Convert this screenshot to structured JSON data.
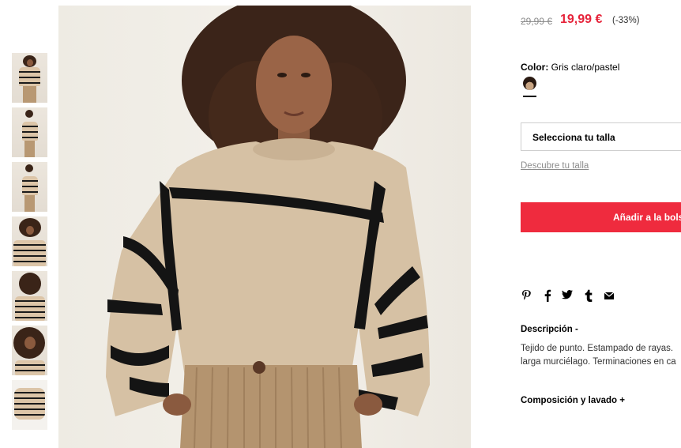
{
  "gallery": {
    "thumbnails": [
      {
        "alt": "model-front-full"
      },
      {
        "alt": "model-side-full"
      },
      {
        "alt": "model-back-full"
      },
      {
        "alt": "model-front-closeup"
      },
      {
        "alt": "model-side-closeup"
      },
      {
        "alt": "model-face-closeup"
      },
      {
        "alt": "sweater-flat"
      }
    ]
  },
  "price": {
    "old": "29,99 €",
    "current": "19,99 €",
    "discount": "(-33%)",
    "sale_color": "#e6233a"
  },
  "color": {
    "label": "Color:",
    "value": "Gris claro/pastel"
  },
  "size": {
    "select_label": "Selecciona tu talla",
    "guide_link": "Descubre tu talla"
  },
  "cart": {
    "add_label": "Añadir a la bolsa",
    "button_color": "#ef2b3e"
  },
  "share": {
    "icons": [
      {
        "name": "pinterest-icon",
        "glyph": "𝒑"
      },
      {
        "name": "facebook-icon",
        "glyph": "f"
      },
      {
        "name": "twitter-icon",
        "glyph": "🐦"
      },
      {
        "name": "tumblr-icon",
        "glyph": "t"
      },
      {
        "name": "email-icon",
        "glyph": "✉"
      }
    ]
  },
  "description": {
    "title": "Descripción -",
    "line1": "Tejido de punto. Estampado de rayas.",
    "line2": "larga murciélago. Terminaciones en ca"
  },
  "composition": {
    "title": "Composición y lavado +"
  }
}
